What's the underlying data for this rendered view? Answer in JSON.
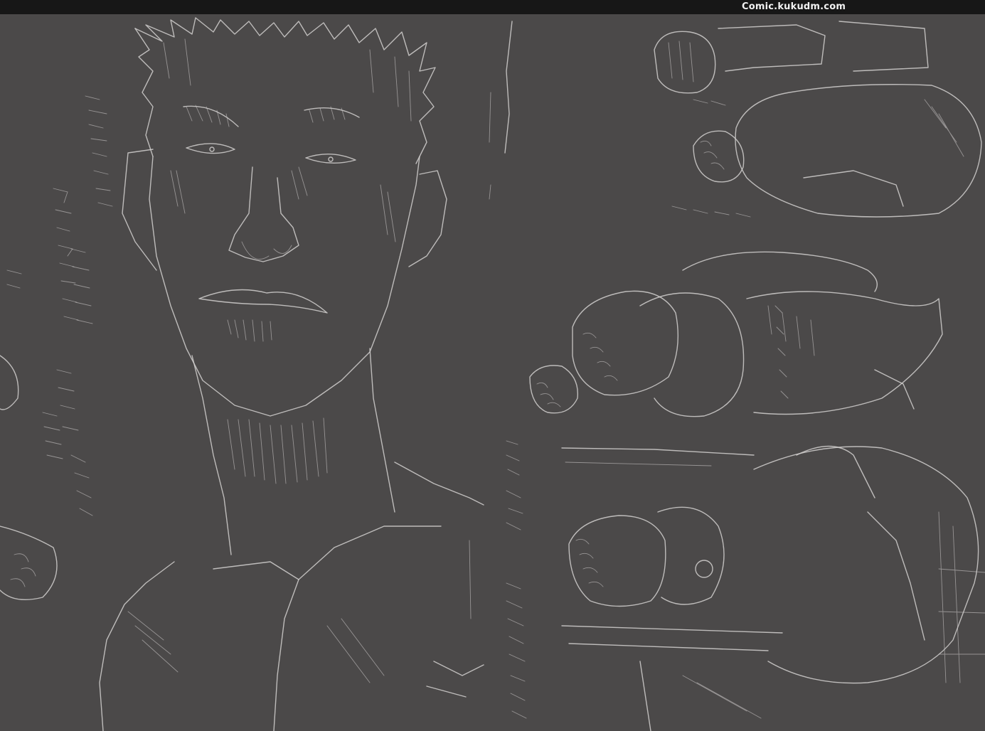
{
  "header": {
    "site_label": "Comic.kukudm.com"
  },
  "image": {
    "background_color": "#4b4949",
    "header_color": "#171717",
    "line_color": "#d2d0cf"
  }
}
